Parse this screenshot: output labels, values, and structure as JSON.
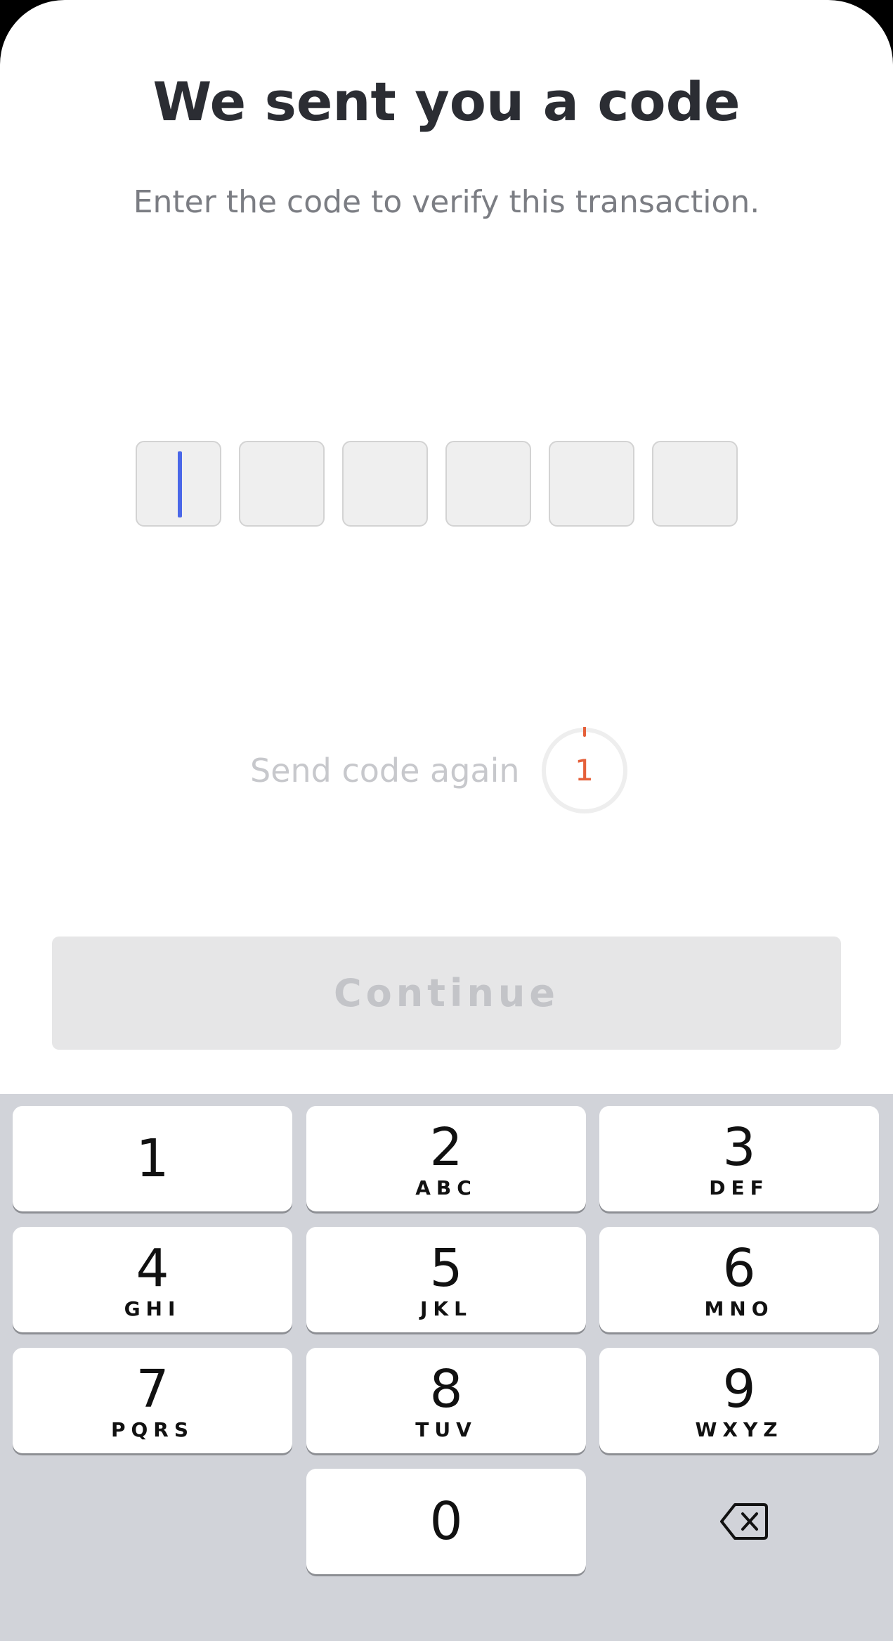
{
  "header": {
    "title": "We sent you a code",
    "subtitle": "Enter the code to verify this transaction."
  },
  "code_input": {
    "length": 6,
    "entered": [
      "",
      "",
      "",
      "",
      "",
      ""
    ],
    "active_index": 0
  },
  "resend": {
    "label": "Send code again",
    "countdown": "1"
  },
  "continue_label": "Continue",
  "keypad": {
    "keys": [
      {
        "digit": "1",
        "letters": ""
      },
      {
        "digit": "2",
        "letters": "ABC"
      },
      {
        "digit": "3",
        "letters": "DEF"
      },
      {
        "digit": "4",
        "letters": "GHI"
      },
      {
        "digit": "5",
        "letters": "JKL"
      },
      {
        "digit": "6",
        "letters": "MNO"
      },
      {
        "digit": "7",
        "letters": "PQRS"
      },
      {
        "digit": "8",
        "letters": "TUV"
      },
      {
        "digit": "9",
        "letters": "WXYZ"
      },
      {
        "digit": "0",
        "letters": ""
      }
    ],
    "backspace_icon": "backspace-icon"
  },
  "colors": {
    "accent_caret": "#4a67e8",
    "timer": "#e5603a",
    "button_disabled_bg": "#e6e6e7",
    "keyboard_bg": "#d1d3d9"
  }
}
